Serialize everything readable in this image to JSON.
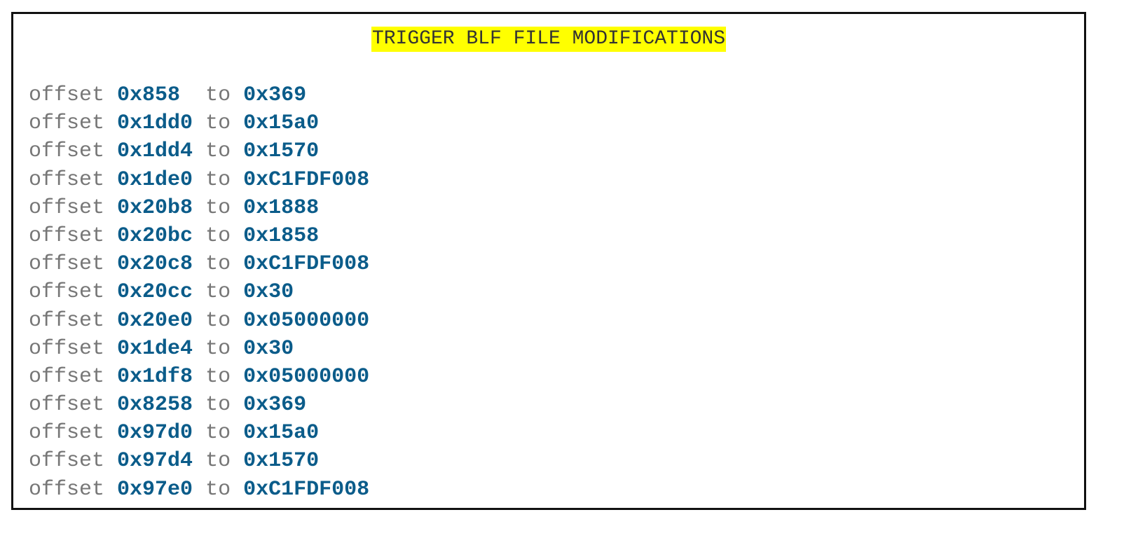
{
  "title": "TRIGGER BLF FILE MODIFICATIONS",
  "keyword_offset": "offset",
  "keyword_to": "to",
  "colors": {
    "title_highlight": "#ffff00",
    "hex_values": "#0b5c8a",
    "keywords": "#777777",
    "border": "#111111"
  },
  "modifications": [
    {
      "offset": "0x858",
      "value": "0x369"
    },
    {
      "offset": "0x1dd0",
      "value": "0x15a0"
    },
    {
      "offset": "0x1dd4",
      "value": "0x1570"
    },
    {
      "offset": "0x1de0",
      "value": "0xC1FDF008"
    },
    {
      "offset": "0x20b8",
      "value": "0x1888"
    },
    {
      "offset": "0x20bc",
      "value": "0x1858"
    },
    {
      "offset": "0x20c8",
      "value": "0xC1FDF008"
    },
    {
      "offset": "0x20cc",
      "value": "0x30"
    },
    {
      "offset": "0x20e0",
      "value": "0x05000000"
    },
    {
      "offset": "0x1de4",
      "value": "0x30"
    },
    {
      "offset": "0x1df8",
      "value": "0x05000000"
    },
    {
      "offset": "0x8258",
      "value": "0x369"
    },
    {
      "offset": "0x97d0",
      "value": "0x15a0"
    },
    {
      "offset": "0x97d4",
      "value": "0x1570"
    },
    {
      "offset": "0x97e0",
      "value": "0xC1FDF008"
    }
  ]
}
